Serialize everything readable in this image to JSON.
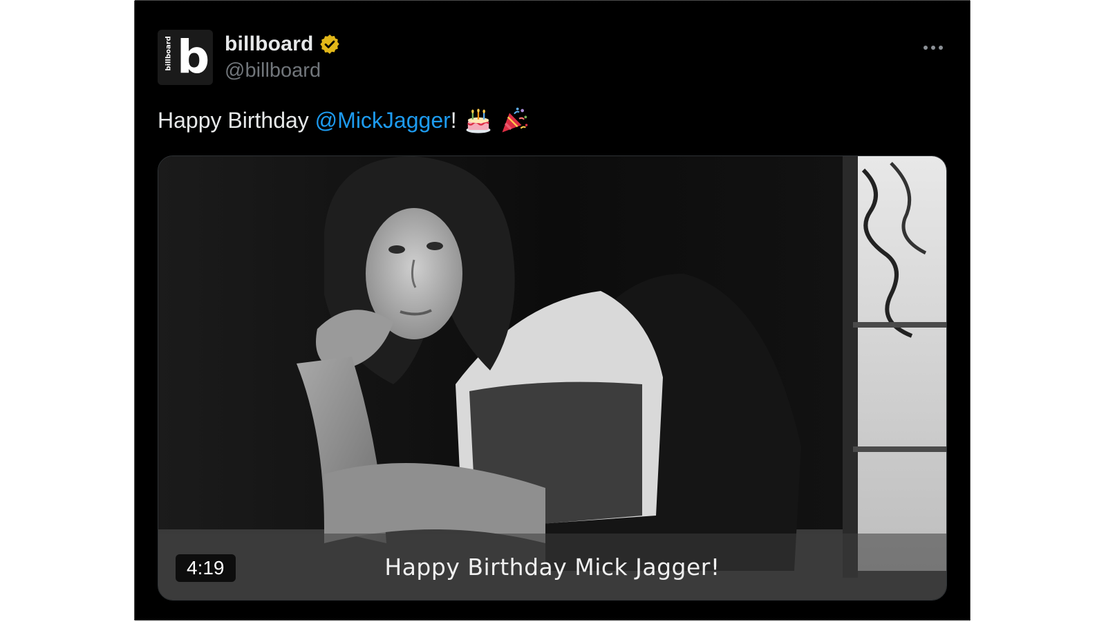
{
  "author": {
    "avatar_letter": "b",
    "avatar_vertical_text": "billboard",
    "display_name": "billboard",
    "handle": "@billboard",
    "verified_badge_icon": "verified-gold-check-icon"
  },
  "menu": {
    "icon": "more-horizontal-icon"
  },
  "tweet": {
    "text_prefix": "Happy Birthday ",
    "mention": "@MickJagger",
    "text_suffix": "!",
    "emojis": [
      "birthday-cake-icon",
      "party-popper-icon"
    ]
  },
  "media": {
    "type": "video",
    "duration": "4:19",
    "caption": "Happy Birthday Mick Jagger!",
    "thumbnail": "black-and-white-portrait-photo"
  },
  "colors": {
    "background": "#000000",
    "mention": "#1d9bf0",
    "verified_badge": "#e2b719",
    "handle": "#71767b"
  }
}
